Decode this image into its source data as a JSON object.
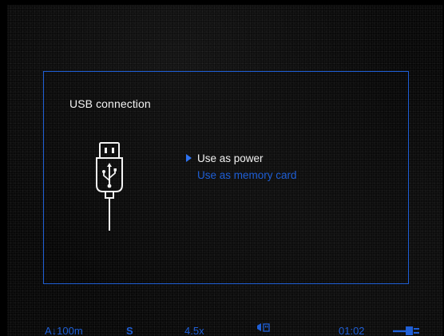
{
  "dialog": {
    "title": "USB connection",
    "icon": "usb-plug-icon",
    "options": [
      {
        "label": "Use as power",
        "selected": true
      },
      {
        "label": "Use as memory card",
        "selected": false
      }
    ]
  },
  "status_bar": {
    "range": "A↓100m",
    "mode": "S",
    "zoom": "4.5x",
    "connection_icon": "usb-connection-icon",
    "time": "01:02",
    "battery_icon": "battery-charging-icon"
  },
  "colors": {
    "accent": "#1f5fd6",
    "text": "#f2f2f2",
    "background": "#070707"
  }
}
